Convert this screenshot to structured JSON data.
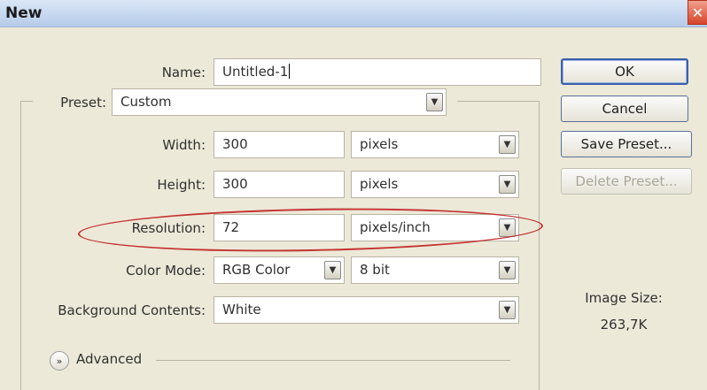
{
  "dialog": {
    "title": "New",
    "close_label": "✕"
  },
  "name": {
    "label": "Name:",
    "value": "Untitled-1"
  },
  "preset": {
    "label": "Preset:",
    "value": "Custom"
  },
  "width": {
    "label": "Width:",
    "value": "300",
    "unit": "pixels"
  },
  "height": {
    "label": "Height:",
    "value": "300",
    "unit": "pixels"
  },
  "resolution": {
    "label": "Resolution:",
    "value": "72",
    "unit": "pixels/inch"
  },
  "color_mode": {
    "label": "Color Mode:",
    "mode": "RGB Color",
    "depth": "8 bit"
  },
  "background": {
    "label": "Background Contents:",
    "value": "White"
  },
  "advanced": {
    "label": "Advanced"
  },
  "buttons": {
    "ok": "OK",
    "cancel": "Cancel",
    "save_preset": "Save Preset...",
    "delete_preset": "Delete Preset..."
  },
  "image_size": {
    "label": "Image Size:",
    "value": "263,7K"
  },
  "highlight_color": "#c43232"
}
